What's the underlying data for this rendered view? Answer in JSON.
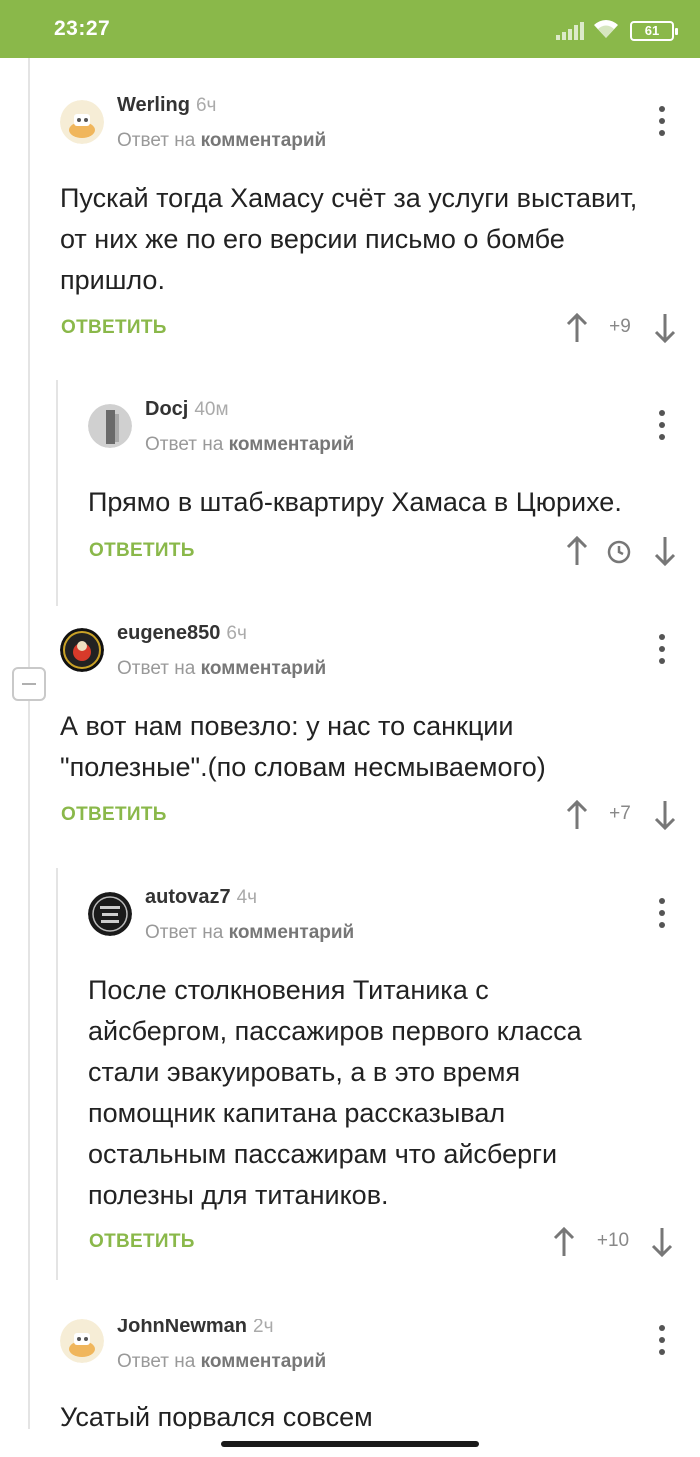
{
  "status_bar": {
    "time": "23:27",
    "battery": "61"
  },
  "reply_label": "ОТВЕТИТЬ",
  "comments": [
    {
      "author": "Werling",
      "ago": "6ч",
      "reply_prefix": "Ответ на",
      "reply_link": "комментарий",
      "text": "Пускай тогда Хамасу счёт за услуги выставит, от них же по его версии письмо о бомбе пришло.",
      "score": "+9"
    },
    {
      "author": "Docj",
      "ago": "40м",
      "reply_prefix": "Ответ на",
      "reply_link": "комментарий",
      "text": "Прямо в штаб-квартиру Хамаса в Цюрихе.",
      "score": ""
    },
    {
      "author": "eugene850",
      "ago": "6ч",
      "reply_prefix": "Ответ на",
      "reply_link": "комментарий",
      "text": "А вот нам повезло: у нас то санкции \"полезные\".(по словам несмываемого)",
      "score": "+7"
    },
    {
      "author": "autovaz7",
      "ago": "4ч",
      "reply_prefix": "Ответ на",
      "reply_link": "комментарий",
      "text": "После столкновения Титаника с айсбергом, пассажиров первого класса стали эвакуировать, а в это время помощник капитана рассказывал остальным пассажирам что айсберги полезны для титаников.",
      "score": "+10"
    },
    {
      "author": "JohnNewman",
      "ago": "2ч",
      "reply_prefix": "Ответ на",
      "reply_link": "комментарий",
      "text": "Усатый порвался совсем",
      "score": ""
    }
  ],
  "icons": {
    "up": "arrow-up-icon",
    "down": "arrow-down-icon",
    "pending": "clock-icon",
    "more": "more-vertical-icon"
  },
  "colors": {
    "accent": "#8ab84a",
    "text": "#222222",
    "muted": "#999999"
  }
}
